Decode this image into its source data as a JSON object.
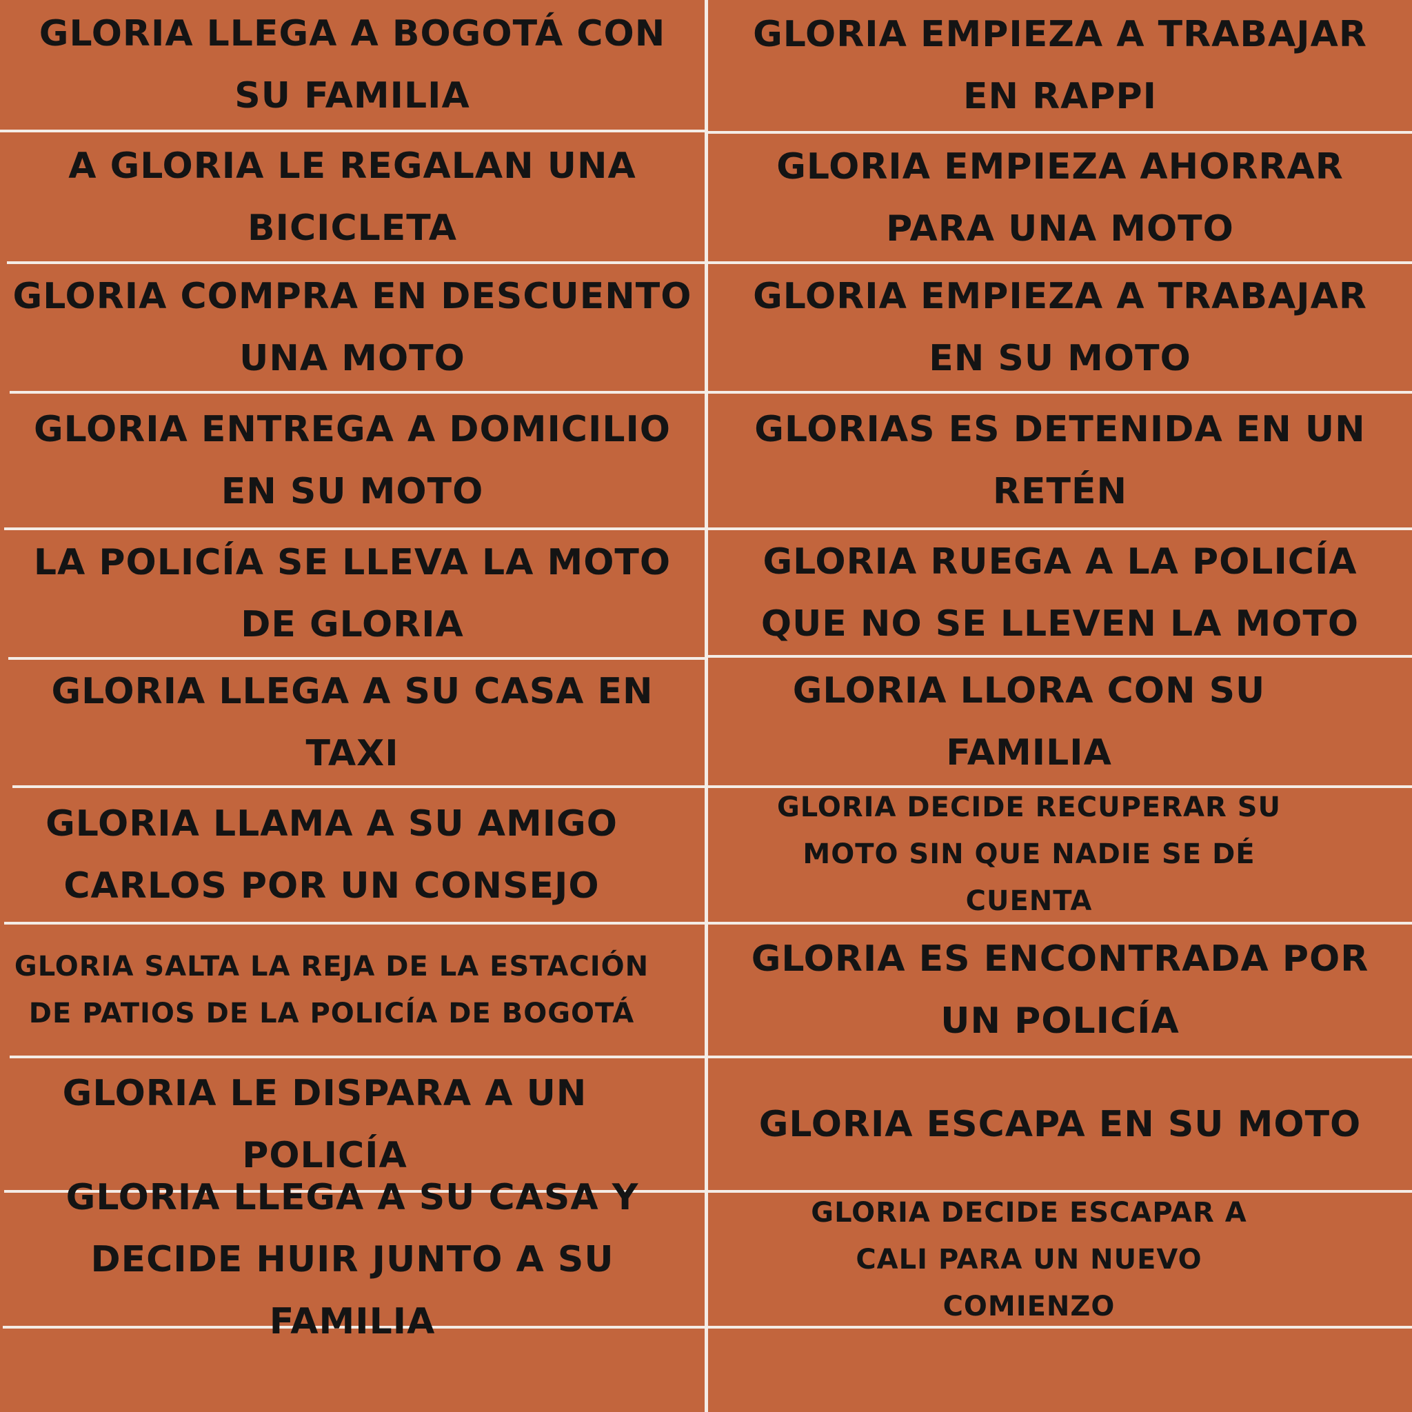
{
  "colors": {
    "background": "#C2653D",
    "lines": "#F4ECE6",
    "text": "#141414"
  },
  "rows": [
    {
      "left": "GLORIA LLEGA A BOGOTÁ CON SU FAMILIA",
      "right": "GLORIA EMPIEZA A TRABAJAR EN RAPPI"
    },
    {
      "left": "A GLORIA LE REGALAN UNA BICICLETA",
      "right": "GLORIA EMPIEZA AHORRAR PARA UNA MOTO"
    },
    {
      "left": "GLORIA COMPRA EN DESCUENTO UNA MOTO",
      "right": "GLORIA EMPIEZA A TRABAJAR EN SU MOTO"
    },
    {
      "left": "GLORIA ENTREGA A DOMICILIO EN SU MOTO",
      "right": "GLORIAS ES DETENIDA EN UN RETÉN"
    },
    {
      "left": "LA POLICÍA SE LLEVA LA MOTO DE GLORIA",
      "right": "GLORIA RUEGA A LA POLICÍA QUE NO SE LLEVEN LA MOTO"
    },
    {
      "left": "GLORIA LLEGA A SU CASA EN TAXI",
      "right": "GLORIA LLORA CON SU FAMILIA"
    },
    {
      "left": "GLORIA LLAMA A SU AMIGO CARLOS POR UN CONSEJO",
      "right": "GLORIA DECIDE RECUPERAR SU MOTO SIN QUE NADIE SE DÉ CUENTA"
    },
    {
      "left": "GLORIA SALTA LA REJA DE LA ESTACIÓN DE PATIOS DE LA POLICÍA DE BOGOTÁ",
      "right": "GLORIA ES ENCONTRADA POR UN POLICÍA"
    },
    {
      "left": "GLORIA LE DISPARA A UN POLICÍA",
      "right": "GLORIA ESCAPA EN SU MOTO"
    },
    {
      "left": "GLORIA LLEGA A SU CASA Y DECIDE HUIR JUNTO A SU FAMILIA",
      "right": "GLORIA DECIDE ESCAPAR A CALI PARA UN NUEVO COMIENZO"
    },
    {
      "left": "",
      "right": ""
    }
  ]
}
